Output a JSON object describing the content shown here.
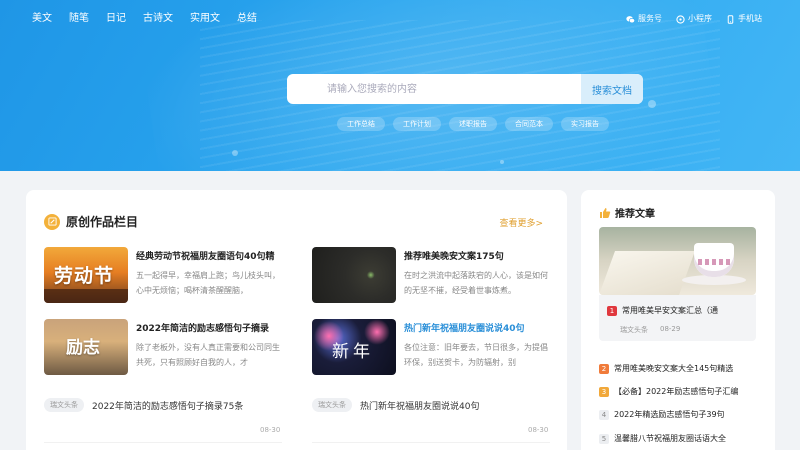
{
  "nav": [
    "美文",
    "随笔",
    "日记",
    "古诗文",
    "实用文",
    "总结"
  ],
  "topright": [
    {
      "label": "服务号",
      "icon": "wechat-icon"
    },
    {
      "label": "小程序",
      "icon": "miniprogram-icon"
    },
    {
      "label": "手机站",
      "icon": "mobile-icon"
    }
  ],
  "search": {
    "placeholder": "请输入您搜索的内容",
    "button": "搜索文档"
  },
  "tags": [
    "工作总结",
    "工作计划",
    "述职报告",
    "合同范本",
    "实习报告"
  ],
  "main": {
    "title": "原创作品栏目",
    "more": "查看更多>",
    "items": [
      {
        "title": "经典劳动节祝福朋友圈语句40句精",
        "desc": "五一起得早，幸福肩上跑；鸟儿枝头叫，心中无烦恼；喝杯清茶醒醒脑，",
        "thumb_text": "劳动节"
      },
      {
        "title": "推荐唯美晚安文案175句",
        "desc": "在时之洪流中起落跌宕的人心，该是如何的无坚不摧，经受着世事炼煮。",
        "thumb_text": ""
      },
      {
        "title": "2022年简洁的励志感悟句子摘录",
        "desc": "除了老板外，没有人真正需要和公司同生共死，只有照顾好自我的人，才",
        "thumb_text": "励志"
      },
      {
        "title": "热门新年祝福朋友圈说说40句",
        "desc": "各位注意：旧年要去，节日很多，为提倡环保，别送贺卡，为防辐射，别",
        "thumb_text": "新年"
      }
    ],
    "headlines": [
      {
        "source": "瑞文头条",
        "text": "2022年简洁的励志感悟句子摘录75条",
        "date": "08-30"
      },
      {
        "source": "瑞文头条",
        "text": "热门新年祝福朋友圈说说40句",
        "date": "08-30"
      }
    ]
  },
  "side": {
    "title": "推荐文章",
    "featured": {
      "num": "1",
      "title": "常用唯美早安文案汇总（通",
      "source": "瑞文头条",
      "date": "08-29"
    },
    "list": [
      {
        "num": "2",
        "title": "常用唯美晚安文案大全145句精选"
      },
      {
        "num": "3",
        "title": "【必备】2022年励志感悟句子汇编"
      },
      {
        "num": "4",
        "title": "2022年精选励志感悟句子39句"
      },
      {
        "num": "5",
        "title": "温馨腊八节祝福朋友圈话语大全"
      }
    ]
  },
  "colors": {
    "hero": "#2aa6ef",
    "accent": "#f3b13a",
    "link_blue": "#2a8fd8"
  }
}
